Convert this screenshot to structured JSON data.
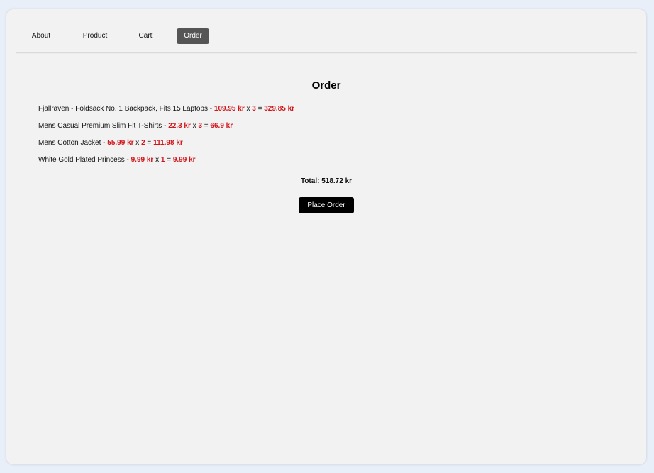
{
  "nav": {
    "items": [
      {
        "label": "About"
      },
      {
        "label": "Product"
      },
      {
        "label": "Cart"
      },
      {
        "label": "Order"
      }
    ],
    "active": "Order"
  },
  "order": {
    "title": "Order",
    "items": [
      {
        "name": "Fjallraven - Foldsack No. 1 Backpack, Fits 15 Laptops",
        "price": "109.95 kr",
        "qty": "3",
        "subtotal": "329.85 kr"
      },
      {
        "name": "Mens Casual Premium Slim Fit T-Shirts",
        "price": "22.3 kr",
        "qty": "3",
        "subtotal": "66.9 kr"
      },
      {
        "name": "Mens Cotton Jacket",
        "price": "55.99 kr",
        "qty": "2",
        "subtotal": "111.98 kr"
      },
      {
        "name": "White Gold Plated Princess",
        "price": "9.99 kr",
        "qty": "1",
        "subtotal": "9.99 kr"
      }
    ],
    "total": "Total: 518.72 kr",
    "place_order_label": "Place Order"
  },
  "colors": {
    "accent_red": "#d0161b",
    "active_nav_bg": "#555555",
    "button_bg": "#000000"
  }
}
